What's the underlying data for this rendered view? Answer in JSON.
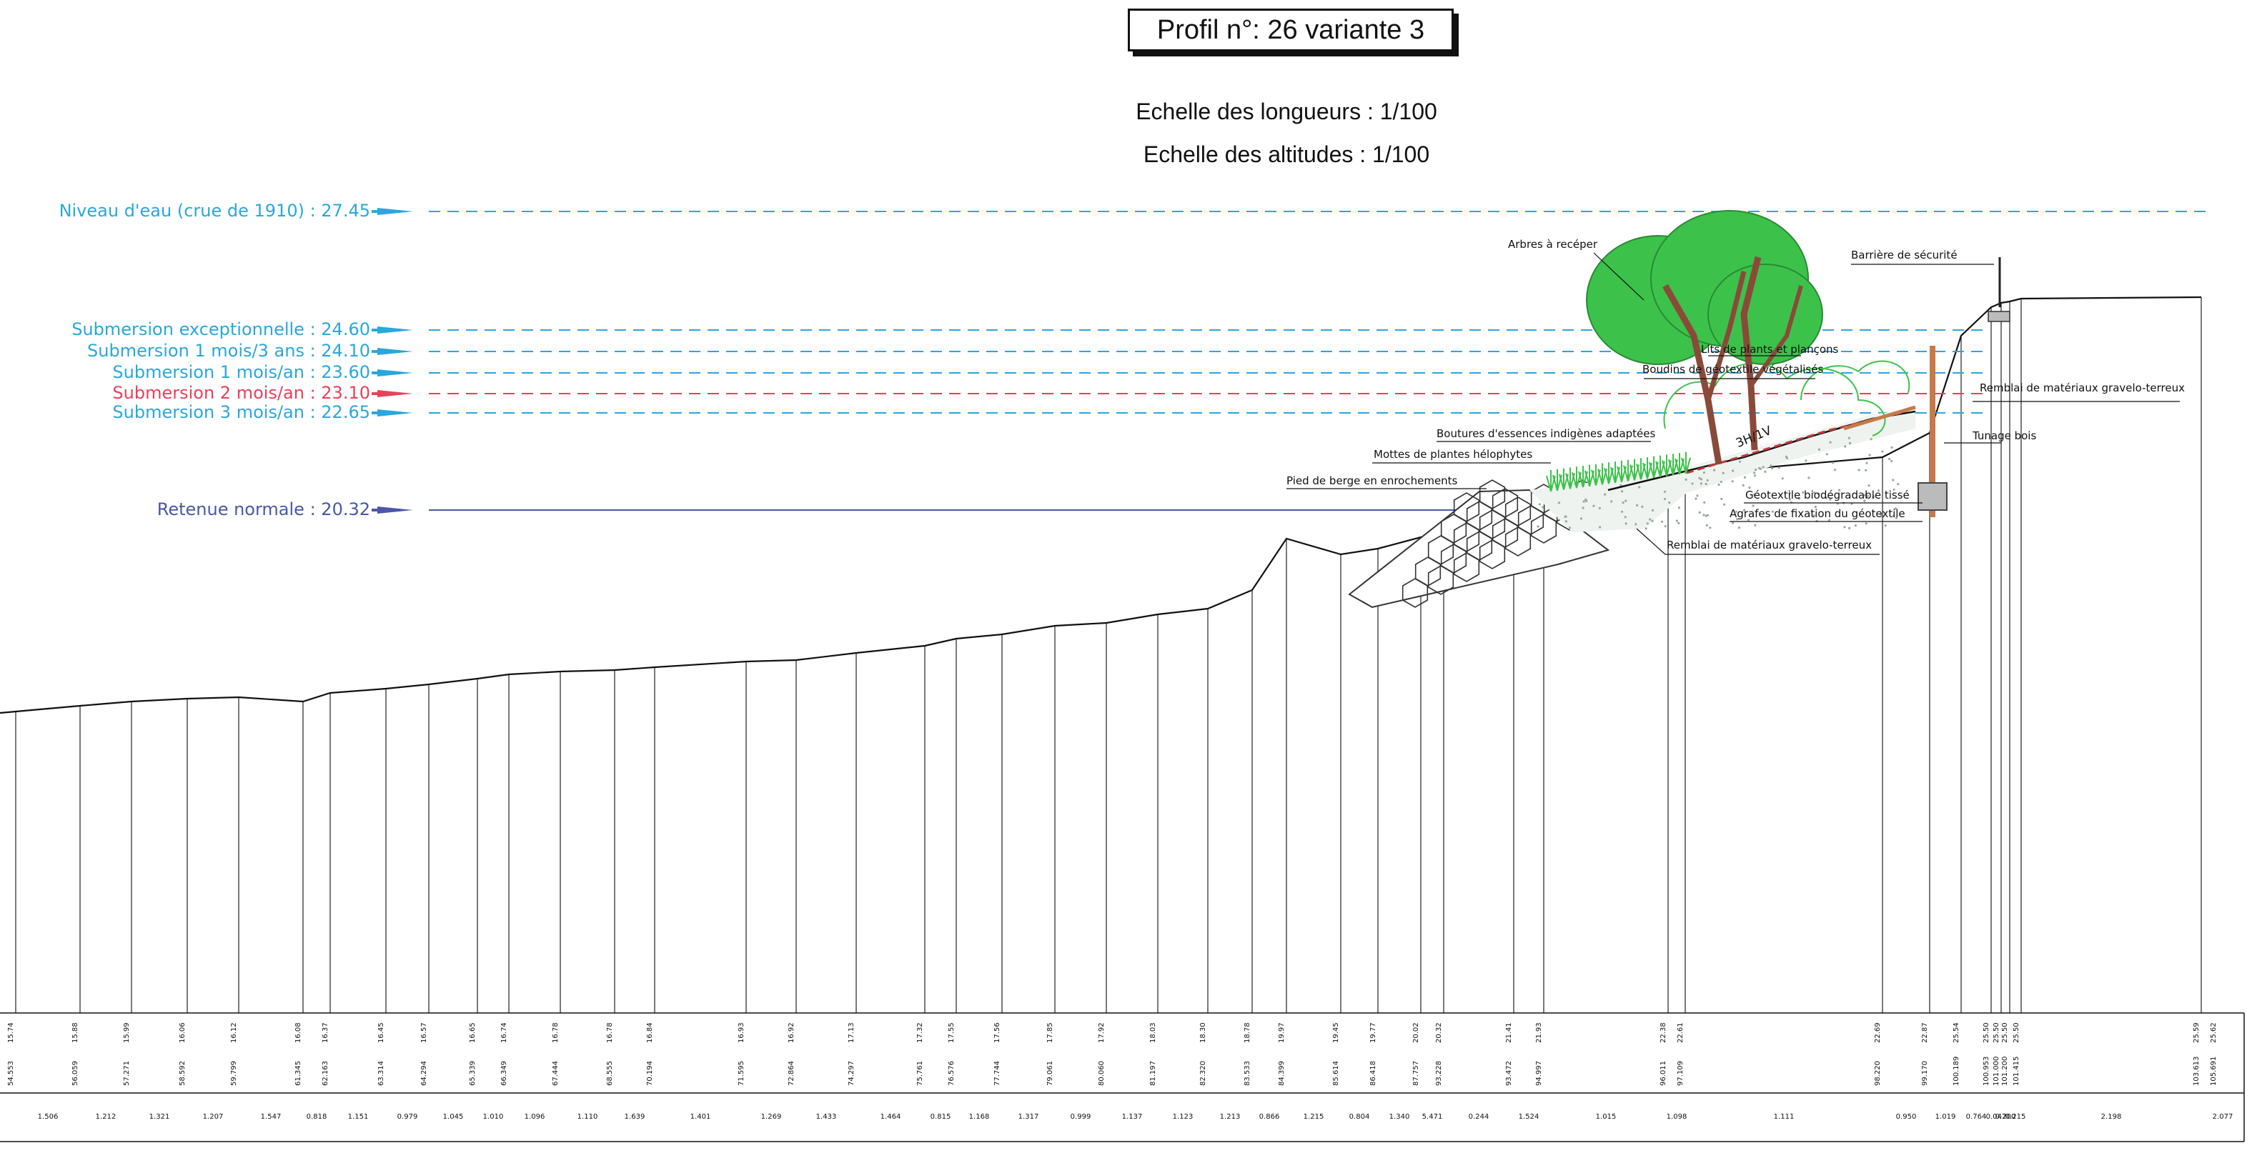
{
  "title": "Profil n°: 26 variante 3",
  "scale_lengths": "Echelle des longueurs : 1/100",
  "scale_altitudes": "Echelle des altitudes : 1/100",
  "colors": {
    "cyan": "#2aa7dd",
    "red": "#e8425a",
    "navy": "#4a57a8",
    "tree": "#3cc24a",
    "trunk": "#8a4a3a",
    "wood": "#c8794a"
  },
  "water_levels": [
    {
      "label": "Niveau d'eau (crue de 1910) : 27.45",
      "color": "#2aa7dd",
      "value": 27.45
    },
    {
      "label": "Submersion exceptionnelle : 24.60",
      "color": "#2aa7dd",
      "value": 24.6
    },
    {
      "label": "Submersion 1 mois/3 ans : 24.10",
      "color": "#2aa7dd",
      "value": 24.1
    },
    {
      "label": "Submersion 1 mois/an : 23.60",
      "color": "#2aa7dd",
      "value": 23.6
    },
    {
      "label": "Submersion 2 mois/an : 23.10",
      "color": "#e8425a",
      "value": 23.1
    },
    {
      "label": "Submersion 3 mois/an : 22.65",
      "color": "#2aa7dd",
      "value": 22.65
    },
    {
      "label": "Retenue normale : 20.32",
      "color": "#4a57a8",
      "value": 20.32
    }
  ],
  "annotations": {
    "arbres": "Arbres à recéper",
    "barriere": "Barrière de sécurité",
    "lits": "Lits de plants et plançons",
    "boudins": "Boudins de géotextile végétalisés",
    "remblai_haut": "Remblai de matériaux gravelo-terreux",
    "tunage": "Tunage bois",
    "boutures": "Boutures d'essences indigènes adaptées",
    "mottes": "Mottes de plantes hélophytes",
    "pied": "Pied de berge en enrochements",
    "geotextile": "Géotextile biodégradable tissé",
    "agrafes": "Agrafes de fixation du géotextile",
    "remblai_bas": "Remblai de matériaux gravelo-terreux",
    "pente": "3H/1V"
  },
  "altitudes": [
    "15.74",
    "15.88",
    "15.99",
    "16.06",
    "16.12",
    "16.08",
    "16.37",
    "16.45",
    "16.57",
    "16.65",
    "16.74",
    "16.78",
    "16.78",
    "16.84",
    "16.93",
    "16.92",
    "17.13",
    "17.32",
    "17.55",
    "17.56",
    "17.85",
    "17.92",
    "18.03",
    "18.30",
    "18.78",
    "19.97",
    "19.45",
    "19.77",
    "20.02",
    "20.32",
    "21.41",
    "21.93",
    "22.38",
    "22.61",
    "22.69",
    "22.87",
    "25.54",
    "25.50",
    "25.50",
    "25.50",
    "25.50",
    "25.59",
    "25.62"
  ],
  "distances_cumulees": [
    "54.553",
    "56.059",
    "57.271",
    "58.592",
    "59.799",
    "61.345",
    "62.163",
    "63.314",
    "64.294",
    "65.339",
    "66.349",
    "67.444",
    "68.555",
    "70.194",
    "71.595",
    "72.864",
    "74.297",
    "75.761",
    "76.576",
    "77.744",
    "79.061",
    "80.060",
    "81.197",
    "82.320",
    "83.533",
    "84.399",
    "85.614",
    "86.418",
    "87.757",
    "93.228",
    "93.472",
    "94.997",
    "96.011",
    "97.109",
    "98.220",
    "99.170",
    "100.189",
    "100.953",
    "101.000",
    "101.200",
    "101.415",
    "103.613",
    "105.691"
  ],
  "distances_partielles": [
    "1.506",
    "1.212",
    "1.321",
    "1.207",
    "1.547",
    "0.818",
    "1.151",
    "0.979",
    "1.045",
    "1.010",
    "1.096",
    "1.110",
    "1.639",
    "1.401",
    "1.269",
    "1.433",
    "1.464",
    "0.815",
    "1.168",
    "1.317",
    "0.999",
    "1.137",
    "1.123",
    "1.213",
    "0.866",
    "1.215",
    "0.804",
    "1.340",
    "5.471",
    "0.244",
    "1.524",
    "1.015",
    "1.098",
    "1.111",
    "0.950",
    "1.019",
    "0.764",
    "0.047",
    "0.200",
    "0.215",
    "2.198",
    "2.077"
  ]
}
